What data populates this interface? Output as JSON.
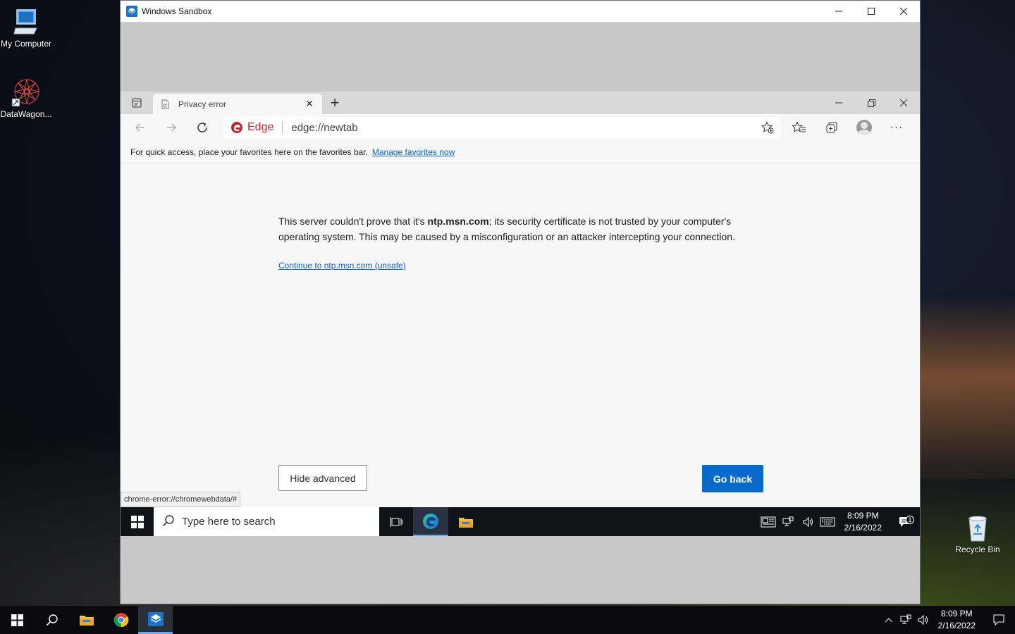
{
  "desktop": {
    "icons": [
      {
        "label": "My Computer"
      },
      {
        "label": "DataWagon..."
      },
      {
        "label": "Recycle Bin"
      }
    ]
  },
  "sandbox": {
    "title": "Windows Sandbox"
  },
  "browser": {
    "tab": {
      "title": "Privacy error"
    },
    "omnibox": {
      "badge": "Edge",
      "url": "edge://newtab"
    },
    "favorites_bar": {
      "message": "For quick access, place your favorites here on the favorites bar.",
      "link": "Manage favorites now"
    },
    "error": {
      "text_before": "This server couldn't prove that it's ",
      "domain": "ntp.msn.com",
      "text_after": "; its security certificate is not trusted by your computer's operating system. This may be caused by a misconfiguration or an attacker intercepting your connection.",
      "continue_link": "Continue to ntp.msn.com (unsafe)",
      "hide_advanced": "Hide advanced",
      "go_back": "Go back"
    },
    "status_url": "chrome-error://chromewebdata/#"
  },
  "sandbox_taskbar": {
    "search_placeholder": "Type here to search",
    "time": "8:09 PM",
    "date": "2/16/2022",
    "notification_count": "1"
  },
  "host_taskbar": {
    "time": "8:09 PM",
    "date": "2/16/2022"
  },
  "colors": {
    "accent": "#0a6ac9",
    "link": "#0b62c8",
    "edge_badge": "#c0262d"
  }
}
